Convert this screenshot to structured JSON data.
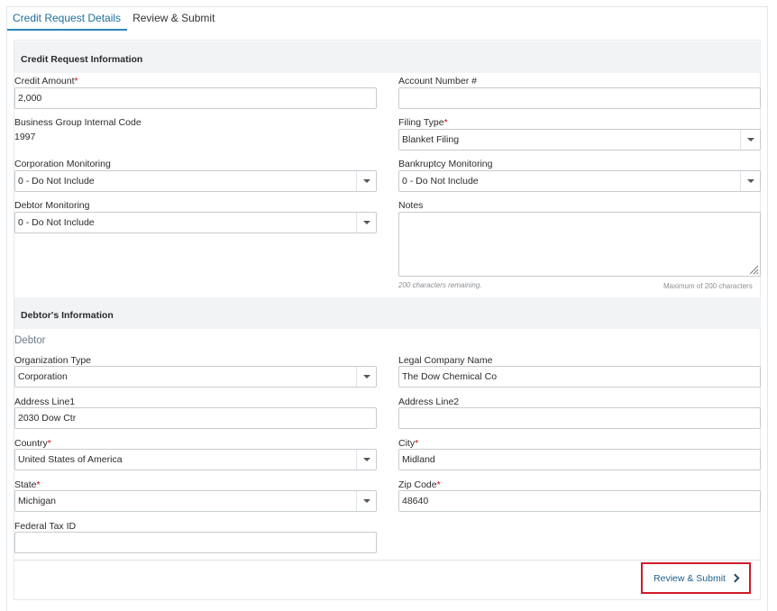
{
  "tabs": [
    {
      "label": "Credit Request Details",
      "active": true
    },
    {
      "label": "Review & Submit",
      "active": false
    }
  ],
  "credit_section": {
    "title": "Credit Request Information",
    "credit_amount": {
      "label": "Credit Amount",
      "required": "*",
      "value": "2,000"
    },
    "account_number": {
      "label": "Account Number #",
      "value": ""
    },
    "business_group": {
      "label": "Business Group Internal Code",
      "value": "1997"
    },
    "filing_type": {
      "label": "Filing Type",
      "required": "*",
      "value": "Blanket Filing"
    },
    "corporation_monitoring": {
      "label": "Corporation Monitoring",
      "value": "0 - Do Not Include"
    },
    "bankruptcy_monitoring": {
      "label": "Bankruptcy Monitoring",
      "value": "0 - Do Not Include"
    },
    "debtor_monitoring": {
      "label": "Debtor Monitoring",
      "value": "0 - Do Not Include"
    },
    "notes": {
      "label": "Notes",
      "value": "",
      "remaining": "200 characters remaining.",
      "max": "Maximum of 200 characters"
    }
  },
  "debtor_section": {
    "title": "Debtor's Information",
    "subtitle": "Debtor",
    "organization_type": {
      "label": "Organization Type",
      "value": "Corporation"
    },
    "legal_company_name": {
      "label": "Legal Company Name",
      "value": "The Dow Chemical Co"
    },
    "address_line1": {
      "label": "Address Line1",
      "value": "2030 Dow Ctr"
    },
    "address_line2": {
      "label": "Address Line2",
      "value": ""
    },
    "country": {
      "label": "Country",
      "required": "*",
      "value": "United States of America"
    },
    "city": {
      "label": "City",
      "required": "*",
      "value": "Midland"
    },
    "state": {
      "label": "State",
      "required": "*",
      "value": "Michigan"
    },
    "zip_code": {
      "label": "Zip Code",
      "required": "*",
      "value": "48640"
    },
    "federal_tax_id": {
      "label": "Federal Tax ID",
      "value": ""
    }
  },
  "footer": {
    "submit_label": "Review & Submit"
  },
  "colors": {
    "accent": "#2a86b8",
    "required": "#d0021b",
    "highlight_border": "#d11a2a"
  }
}
